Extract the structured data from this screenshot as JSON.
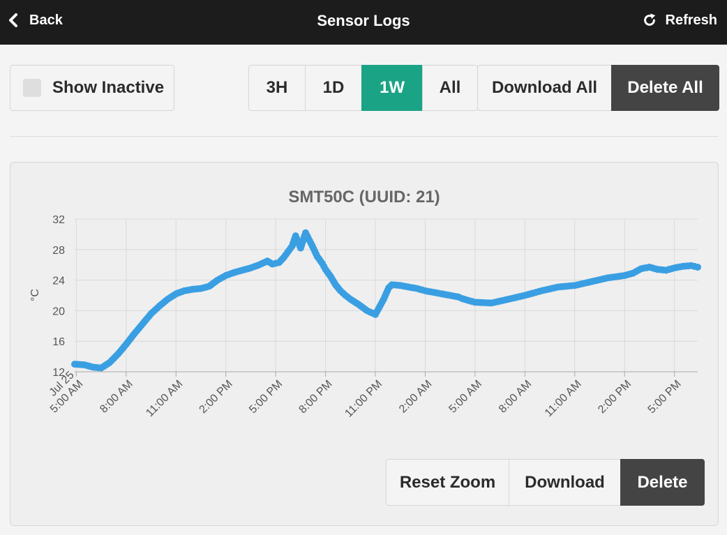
{
  "header": {
    "back_label": "Back",
    "title": "Sensor Logs",
    "refresh_label": "Refresh"
  },
  "filters": {
    "show_inactive_label": "Show Inactive",
    "show_inactive_checked": false,
    "ranges": [
      "3H",
      "1D",
      "1W",
      "All"
    ],
    "active_range": "1W",
    "download_all_label": "Download All",
    "delete_all_label": "Delete All"
  },
  "card": {
    "reset_zoom_label": "Reset Zoom",
    "download_label": "Download",
    "delete_label": "Delete"
  },
  "colors": {
    "accent": "#1aa385",
    "dark_button": "#444444",
    "series": "#3b9fe2",
    "topbar": "#1c1c1c"
  },
  "icons": {
    "back": "chevron-left-icon",
    "refresh": "refresh-icon"
  },
  "chart_data": {
    "type": "line",
    "title": "SMT50C (UUID: 21)",
    "ylabel": "°C",
    "xlabel": "",
    "ylim": [
      12,
      32
    ],
    "yticks": [
      12,
      16,
      20,
      24,
      28,
      32
    ],
    "grid": true,
    "xticks": [
      "Jul 25\n5:00 AM",
      "8:00 AM",
      "11:00 AM",
      "2:00 PM",
      "5:00 PM",
      "8:00 PM",
      "11:00 PM",
      "2:00 AM",
      "5:00 AM",
      "8:00 AM",
      "11:00 AM",
      "2:00 PM",
      "5:00 PM"
    ],
    "xrange_hours": [
      -0.1,
      37.4
    ],
    "series": [
      {
        "x": [
          -0.1,
          0.5,
          1.0,
          1.5,
          2.0,
          2.5,
          3.0,
          3.5,
          4.0,
          4.5,
          5.0,
          5.5,
          6.0,
          6.5,
          7.0,
          7.5,
          8.0,
          8.5,
          9.0,
          9.5,
          10.0,
          10.5,
          11.0,
          11.5,
          11.8,
          12.2,
          12.5,
          12.7,
          13.0,
          13.2,
          13.5,
          13.8,
          14.2,
          14.5,
          14.8,
          15.0,
          15.3,
          15.6,
          15.9,
          16.2,
          16.5,
          17.0,
          17.5,
          18.0,
          18.5,
          18.8,
          19.0,
          19.5,
          20.0,
          20.5,
          21.0,
          21.5,
          22.0,
          22.5,
          23.0,
          23.2,
          23.5,
          24.0,
          25.0,
          26.0,
          27.0,
          28.0,
          29.0,
          30.0,
          31.0,
          32.0,
          33.0,
          33.5,
          34.0,
          34.5,
          35.0,
          35.5,
          36.0,
          36.5,
          37.0,
          37.4
        ],
        "y": [
          13.0,
          12.9,
          12.6,
          12.5,
          13.2,
          14.3,
          15.6,
          17.0,
          18.3,
          19.6,
          20.6,
          21.5,
          22.2,
          22.6,
          22.8,
          22.9,
          23.2,
          24.0,
          24.6,
          25.0,
          25.3,
          25.6,
          26.0,
          26.5,
          26.1,
          26.3,
          27.0,
          27.6,
          28.5,
          29.8,
          28.2,
          30.2,
          28.5,
          27.1,
          26.2,
          25.4,
          24.5,
          23.4,
          22.6,
          22.0,
          21.5,
          20.8,
          20.0,
          19.5,
          21.5,
          23.0,
          23.4,
          23.3,
          23.1,
          22.9,
          22.6,
          22.4,
          22.2,
          22.0,
          21.8,
          21.6,
          21.4,
          21.1,
          21.0,
          21.5,
          22.0,
          22.6,
          23.1,
          23.3,
          23.8,
          24.3,
          24.6,
          24.9,
          25.5,
          25.7,
          25.4,
          25.3,
          25.6,
          25.8,
          25.9,
          25.7
        ]
      }
    ]
  }
}
